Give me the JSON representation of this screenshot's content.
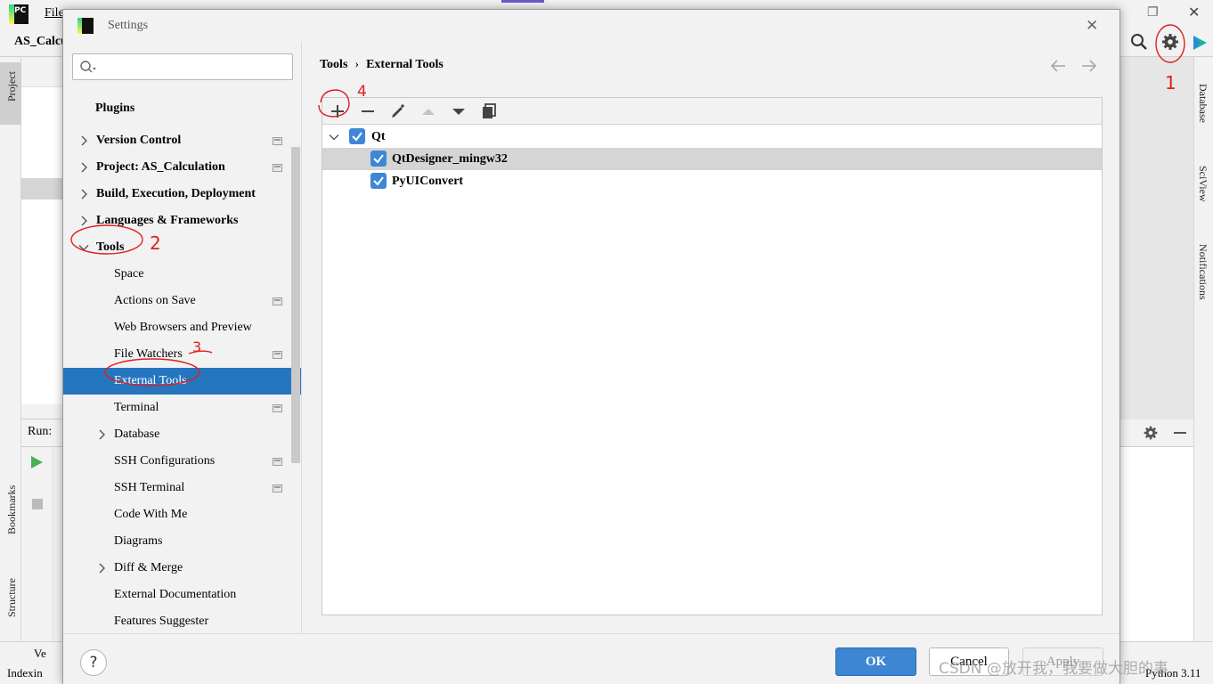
{
  "ide": {
    "logo_text": "PC",
    "file_menu": "File",
    "project_name": "AS_Calcu",
    "left_tabs": {
      "project": "Project",
      "bookmarks": "Bookmarks",
      "structure": "Structure"
    },
    "right_tabs": {
      "database": "Database",
      "sciview": "SciView",
      "notifications": "Notifications"
    },
    "run_label": "Run:",
    "vcs_label": "Ve",
    "status_text": "Indexin",
    "python_version": "Python 3.11"
  },
  "dialog": {
    "title": "Settings",
    "close_glyph": "✕",
    "search": {
      "value": "",
      "placeholder": ""
    },
    "sidebar": {
      "plugins": "Plugins",
      "version_control": "Version Control",
      "project": "Project: AS_Calculation",
      "build": "Build, Execution, Deployment",
      "languages": "Languages & Frameworks",
      "tools": "Tools",
      "space": "Space",
      "actions_on_save": "Actions on Save",
      "web_browsers": "Web Browsers and Preview",
      "file_watchers": "File Watchers",
      "external_tools": "External Tools",
      "terminal": "Terminal",
      "database": "Database",
      "ssh_configurations": "SSH Configurations",
      "ssh_terminal": "SSH Terminal",
      "code_with_me": "Code With Me",
      "diagrams": "Diagrams",
      "diff_merge": "Diff & Merge",
      "external_documentation": "External Documentation",
      "features_suggester": "Features Suggester"
    },
    "breadcrumb": {
      "parent": "Tools",
      "separator": "›",
      "current": "External Tools"
    },
    "tree": {
      "group": "Qt",
      "children": [
        "QtDesigner_mingw32",
        "PyUIConvert"
      ]
    },
    "buttons": {
      "help": "?",
      "ok": "OK",
      "cancel": "Cancel",
      "apply": "Apply"
    }
  },
  "annotations": [
    "1",
    "2",
    "3",
    "4"
  ],
  "watermark": "CSDN @放开我，我要做大胆的事",
  "colors": {
    "accent": "#2675bf",
    "checkbox": "#3e87d6",
    "ok_button": "#3c86d4",
    "annotation": "#e02020",
    "panel_bg": "#f2f2f2"
  },
  "icons": {
    "search": "search-icon",
    "add": "plus-icon",
    "remove": "minus-icon",
    "edit": "pencil-icon",
    "move_up": "arrow-up-icon",
    "move_down": "arrow-down-icon",
    "copy": "copy-icon",
    "back": "arrow-left-icon",
    "forward": "arrow-right-icon",
    "settings": "gear-icon"
  }
}
